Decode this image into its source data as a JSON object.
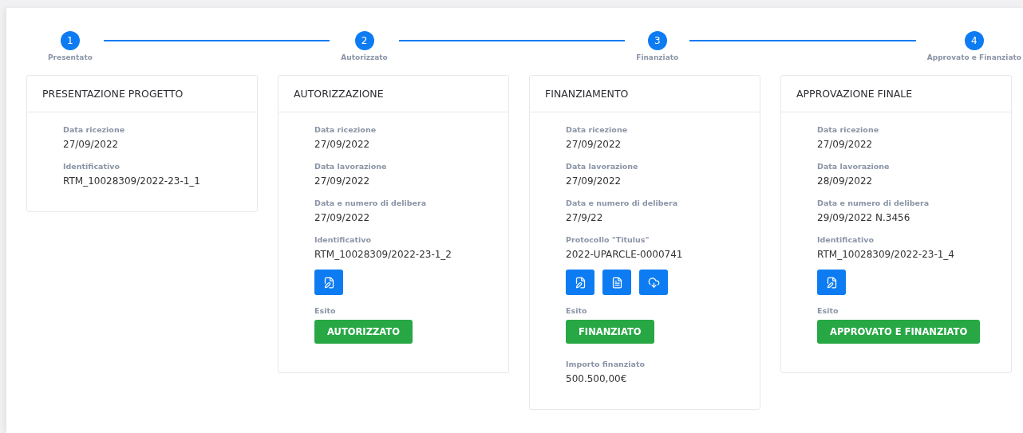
{
  "steps": [
    {
      "number": "1",
      "label": "Presentato"
    },
    {
      "number": "2",
      "label": "Autorizzato"
    },
    {
      "number": "3",
      "label": "Finanziato"
    },
    {
      "number": "4",
      "label": "Approvato e Finanziato"
    }
  ],
  "cards": [
    {
      "title": "PRESENTAZIONE PROGETTO",
      "items": [
        {
          "kind": "field",
          "label": "Data ricezione",
          "value": "27/09/2022"
        },
        {
          "kind": "field",
          "label": "Identificativo",
          "value": "RTM_10028309/2022-23-1_1"
        }
      ]
    },
    {
      "title": "AUTORIZZAZIONE",
      "items": [
        {
          "kind": "field",
          "label": "Data ricezione",
          "value": "27/09/2022"
        },
        {
          "kind": "field",
          "label": "Data lavorazione",
          "value": "27/09/2022"
        },
        {
          "kind": "field",
          "label": "Data e numero di delibera",
          "value": "27/09/2022"
        },
        {
          "kind": "field",
          "label": "Identificativo",
          "value": "RTM_10028309/2022-23-1_2"
        },
        {
          "kind": "actions",
          "icons": [
            {
              "kind": "edit"
            }
          ]
        },
        {
          "kind": "outcome",
          "label": "Esito",
          "value": "AUTORIZZATO"
        }
      ]
    },
    {
      "title": "FINANZIAMENTO",
      "items": [
        {
          "kind": "field",
          "label": "Data ricezione",
          "value": "27/09/2022"
        },
        {
          "kind": "field",
          "label": "Data lavorazione",
          "value": "27/09/2022"
        },
        {
          "kind": "field",
          "label": "Data e numero di delibera",
          "value": "27/9/22"
        },
        {
          "kind": "field",
          "label": "Protocollo \"Titulus\"",
          "value": "2022-UPARCLE-0000741"
        },
        {
          "kind": "actions",
          "icons": [
            {
              "kind": "edit"
            },
            {
              "kind": "document"
            },
            {
              "kind": "download"
            }
          ]
        },
        {
          "kind": "outcome",
          "label": "Esito",
          "value": "FINANZIATO"
        },
        {
          "kind": "field",
          "label": "Importo finanziato",
          "value": "500.500,00€"
        }
      ]
    },
    {
      "title": "APPROVAZIONE FINALE",
      "items": [
        {
          "kind": "field",
          "label": "Data ricezione",
          "value": "27/09/2022"
        },
        {
          "kind": "field",
          "label": "Data lavorazione",
          "value": "28/09/2022"
        },
        {
          "kind": "field",
          "label": "Data e numero di delibera",
          "value": "29/09/2022 N.3456"
        },
        {
          "kind": "field",
          "label": "Identificativo",
          "value": "RTM_10028309/2022-23-1_4"
        },
        {
          "kind": "actions",
          "icons": [
            {
              "kind": "edit"
            }
          ]
        },
        {
          "kind": "outcome",
          "label": "Esito",
          "value": "APPROVATO E FINANZIATO"
        }
      ]
    }
  ]
}
